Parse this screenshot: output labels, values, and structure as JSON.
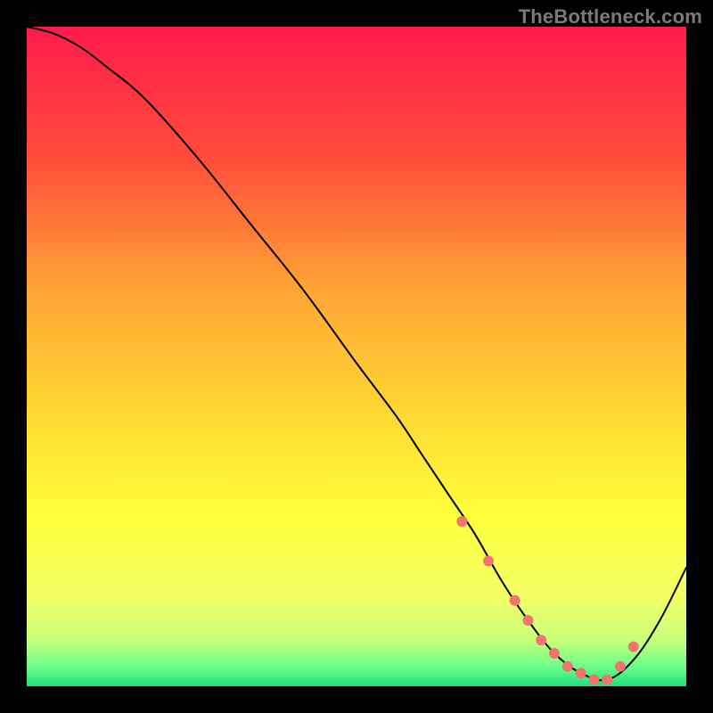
{
  "watermark": "TheBottleneck.com",
  "chart_data": {
    "type": "line",
    "title": "",
    "xlabel": "",
    "ylabel": "",
    "xlim": [
      0,
      100
    ],
    "ylim": [
      0,
      100
    ],
    "grid": false,
    "background": {
      "kind": "vertical-gradient",
      "stops": [
        {
          "pos": 0.0,
          "color": "#ff1a4d"
        },
        {
          "pos": 0.2,
          "color": "#ff4d3a"
        },
        {
          "pos": 0.4,
          "color": "#ffa534"
        },
        {
          "pos": 0.58,
          "color": "#ffd633"
        },
        {
          "pos": 0.74,
          "color": "#ffff3a"
        },
        {
          "pos": 0.86,
          "color": "#f4ff66"
        },
        {
          "pos": 0.93,
          "color": "#c8ff7a"
        },
        {
          "pos": 0.97,
          "color": "#6cff8a"
        },
        {
          "pos": 1.0,
          "color": "#1fe07a"
        }
      ]
    },
    "series": [
      {
        "name": "bottleneck-curve",
        "stroke": "#000000",
        "stroke_width": 2,
        "x": [
          0,
          4,
          8,
          12,
          18,
          26,
          34,
          42,
          50,
          56,
          60,
          64,
          68,
          72,
          76,
          80,
          84,
          88,
          92,
          96,
          100
        ],
        "y": [
          100,
          99,
          97,
          94,
          89,
          80,
          70,
          60,
          49,
          41,
          35,
          29,
          23,
          16,
          10,
          5,
          2,
          1,
          4,
          10,
          18
        ]
      }
    ],
    "markers": {
      "name": "highlight-dots",
      "color": "#f0766d",
      "radius": 6,
      "x": [
        66,
        70,
        74,
        76,
        78,
        80,
        82,
        84,
        86,
        88,
        90,
        92
      ],
      "y": [
        25,
        19,
        13,
        10,
        7,
        5,
        3,
        2,
        1,
        1,
        3,
        6
      ]
    }
  }
}
